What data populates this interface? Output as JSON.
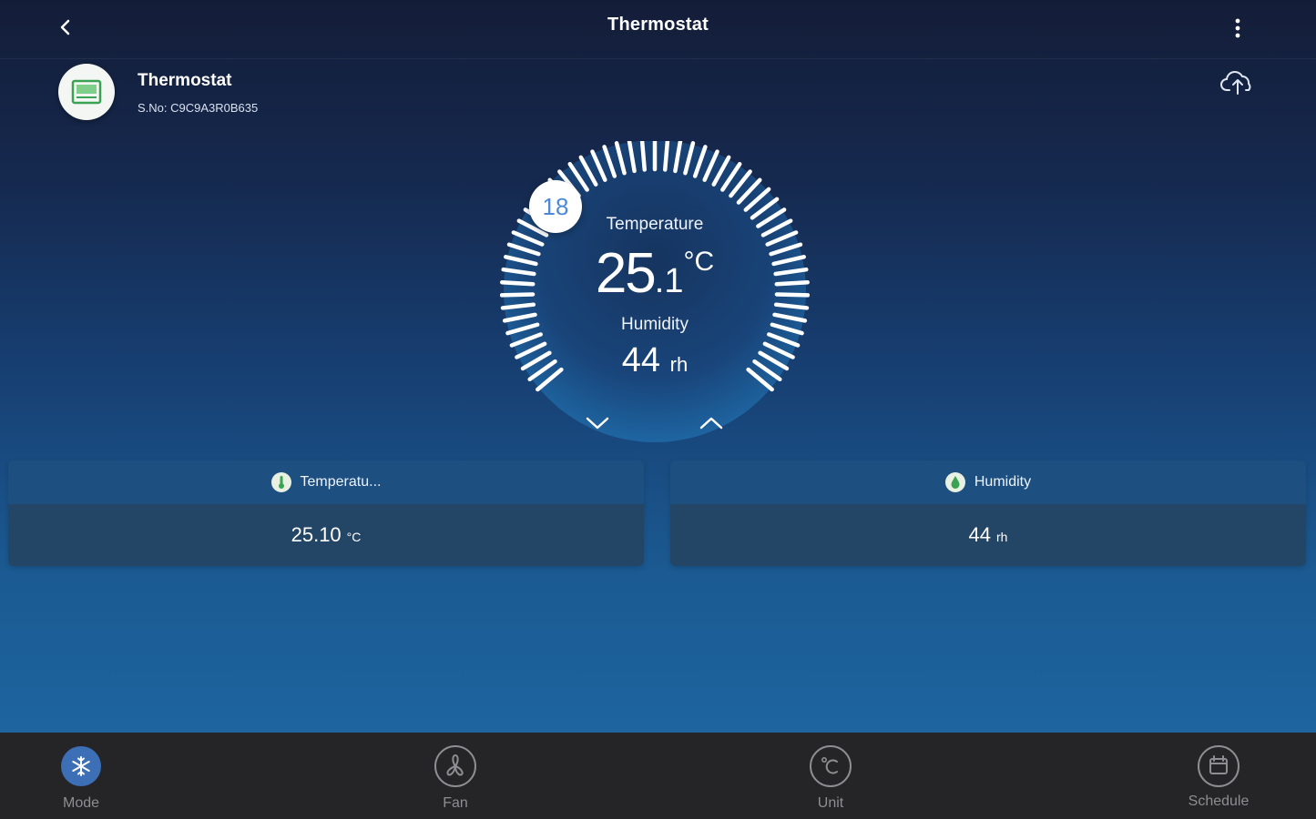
{
  "header": {
    "title": "Thermostat"
  },
  "device": {
    "name": "Thermostat",
    "serial": "S.No: C9C9A3R0B635"
  },
  "dial": {
    "setpoint": "18",
    "temperature_label": "Temperature",
    "temperature_int": "25",
    "temperature_dec": ".1",
    "temperature_unit": "°C",
    "humidity_label": "Humidity",
    "humidity_value": "44",
    "humidity_unit": "rh"
  },
  "cards": [
    {
      "title": "Temperatu...",
      "value": "25.10",
      "unit": "°C",
      "icon": "thermometer-icon"
    },
    {
      "title": "Humidity",
      "value": "44",
      "unit": "rh",
      "icon": "humidity-drop-icon"
    }
  ],
  "bottom_nav": [
    {
      "label": "Mode",
      "icon": "snowflake-icon",
      "active": true
    },
    {
      "label": "Fan",
      "icon": "fan-icon",
      "active": false
    },
    {
      "label": "Unit",
      "icon": "celsius-icon",
      "active": false
    },
    {
      "label": "Schedule",
      "icon": "calendar-icon",
      "active": false
    }
  ],
  "colors": {
    "accent": "#4d88d8",
    "nav_background": "#252527",
    "active_tab": "#3d6fb6",
    "card_header": "#1d4f80",
    "card_body": "#234666"
  }
}
